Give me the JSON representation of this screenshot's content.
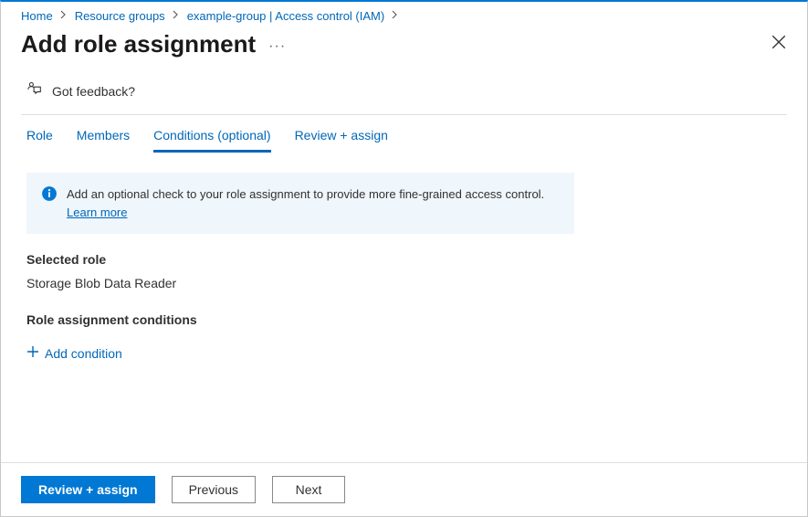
{
  "breadcrumb": {
    "home": "Home",
    "resource_groups": "Resource groups",
    "example_group": "example-group | Access control (IAM)"
  },
  "title": "Add role assignment",
  "feedback_label": "Got feedback?",
  "tabs": {
    "role": "Role",
    "members": "Members",
    "conditions": "Conditions (optional)",
    "review": "Review + assign"
  },
  "info_banner": {
    "text": "Add an optional check to your role assignment to provide more fine-grained access control. ",
    "learn_more": "Learn more"
  },
  "selected_role_label": "Selected role",
  "selected_role_value": "Storage Blob Data Reader",
  "conditions_label": "Role assignment conditions",
  "add_condition": "Add condition",
  "footer": {
    "review": "Review + assign",
    "previous": "Previous",
    "next": "Next"
  }
}
